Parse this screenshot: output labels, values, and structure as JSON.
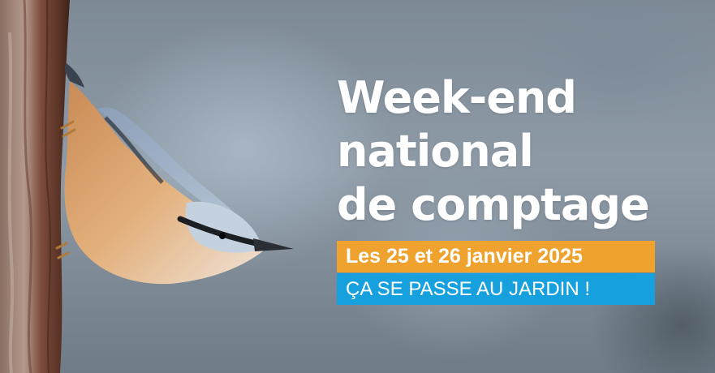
{
  "headline": {
    "line1": "Week-end",
    "line2": "national",
    "line3": "de comptage"
  },
  "date_banner": {
    "text": "Les 25 et 26 janvier 2025",
    "color": "#f0a22e"
  },
  "slogan_banner": {
    "text": "ÇA SE PASSE AU JARDIN !",
    "color": "#17a0de"
  }
}
